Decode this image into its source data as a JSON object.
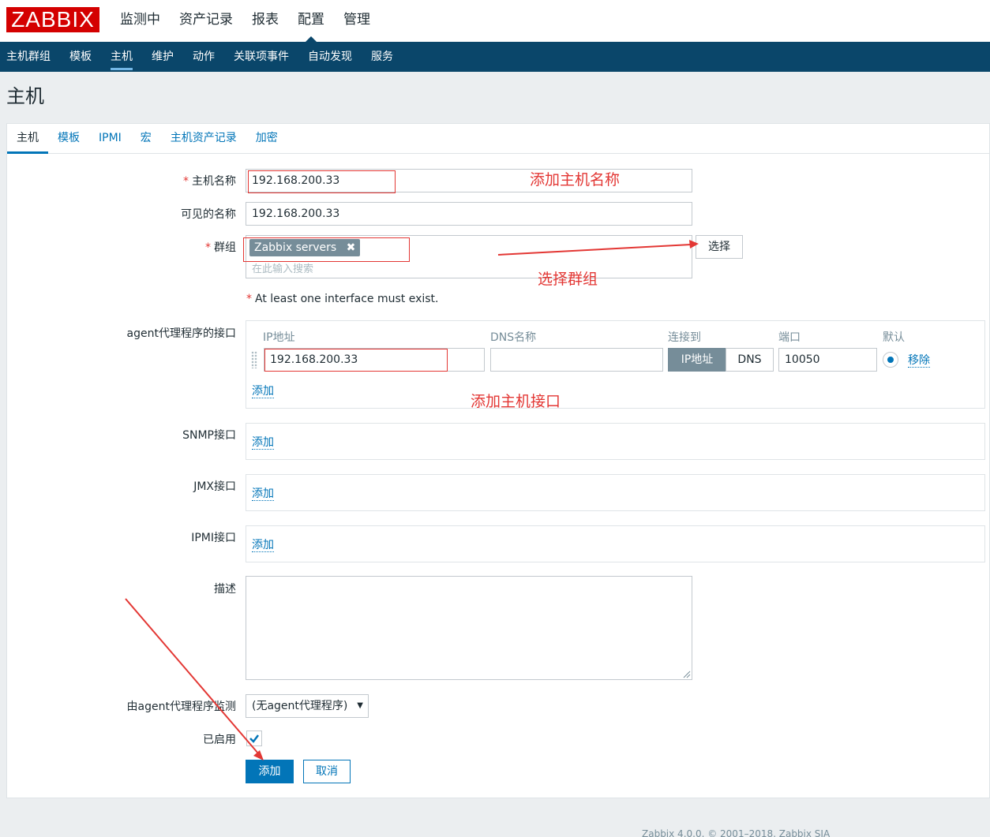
{
  "logo": "ZABBIX",
  "main_menu": [
    "监测中",
    "资产记录",
    "报表",
    "配置",
    "管理"
  ],
  "sub_menu": [
    "主机群组",
    "模板",
    "主机",
    "维护",
    "动作",
    "关联项事件",
    "自动发现",
    "服务"
  ],
  "page_title": "主机",
  "tabs": [
    "主机",
    "模板",
    "IPMI",
    "宏",
    "主机资产记录",
    "加密"
  ],
  "form": {
    "host_name_label": "主机名称",
    "host_name_value": "192.168.200.33",
    "visible_name_label": "可见的名称",
    "visible_name_value": "192.168.200.33",
    "groups_label": "群组",
    "group_chip": "Zabbix servers",
    "group_search_placeholder": "在此输入搜索",
    "select_button": "选择",
    "required_star": "*",
    "interface_note": "At least one interface must exist.",
    "agent_iface_label": "agent代理程序的接口",
    "iface_headers": {
      "ip": "IP地址",
      "dns": "DNS名称",
      "connect": "连接到",
      "port": "端口",
      "default": "默认"
    },
    "iface_ip_value": "192.168.200.33",
    "iface_dns_value": "",
    "connect_ip": "IP地址",
    "connect_dns": "DNS",
    "iface_port_value": "10050",
    "remove_link": "移除",
    "add_link": "添加",
    "snmp_label": "SNMP接口",
    "jmx_label": "JMX接口",
    "ipmi_label": "IPMI接口",
    "desc_label": "描述",
    "proxy_label": "由agent代理程序监测",
    "proxy_value": "(无agent代理程序)",
    "enabled_label": "已启用",
    "add_button": "添加",
    "cancel_button": "取消"
  },
  "annotations": {
    "host_name": "添加主机名称",
    "group": "选择群组",
    "interface": "添加主机接口"
  },
  "footer": "Zabbix 4.0.0. © 2001–2018, Zabbix SIA",
  "colors": {
    "brand_red": "#d40000",
    "nav_blue": "#0a466a",
    "link_blue": "#0275b8",
    "annotation_red": "#e33734"
  }
}
